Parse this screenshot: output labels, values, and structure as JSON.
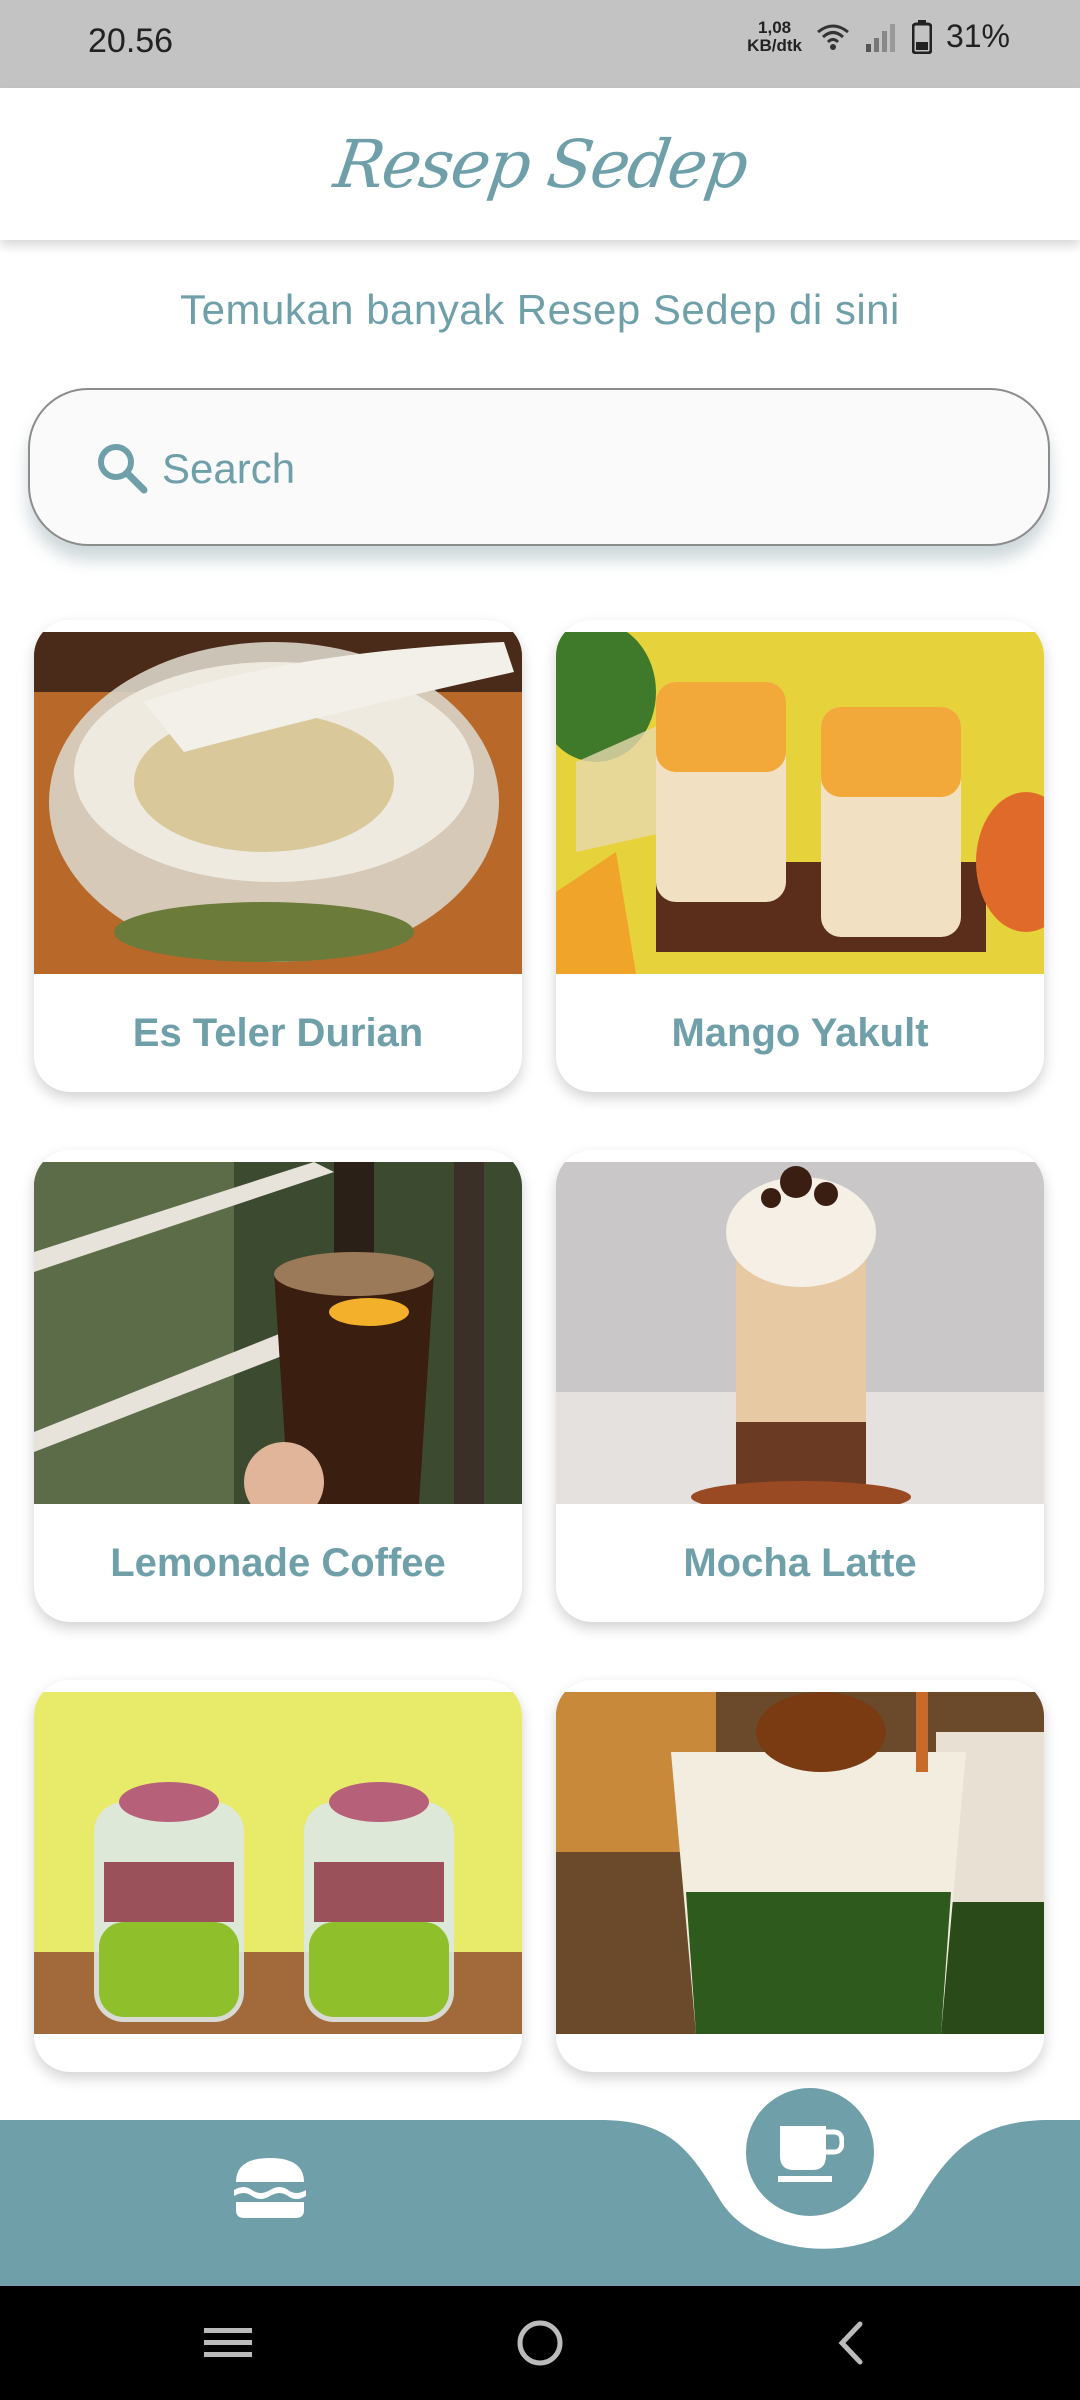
{
  "status_bar": {
    "time": "20.56",
    "net_speed_value": "1,08",
    "net_speed_unit": "KB/dtk",
    "battery": "31%"
  },
  "app_bar": {
    "title": "Resep Sedep"
  },
  "subtitle": "Temukan banyak Resep Sedep di sini",
  "search": {
    "placeholder": "Search",
    "value": ""
  },
  "recipes": [
    {
      "name": "Es Teler Durian"
    },
    {
      "name": "Mango Yakult"
    },
    {
      "name": "Lemonade Coffee"
    },
    {
      "name": "Mocha Latte"
    },
    {
      "name": ""
    },
    {
      "name": ""
    }
  ],
  "bottom_nav": {
    "items": [
      {
        "icon": "burger-icon",
        "active": false
      },
      {
        "icon": "coffee-cup-icon",
        "active": true
      }
    ]
  },
  "system_nav": {
    "icons": [
      "recents-icon",
      "home-icon",
      "back-icon"
    ]
  },
  "colors": {
    "accent": "#6fa0aa",
    "status_bar": "#c3c3c3",
    "nav_bar": "#000000"
  }
}
